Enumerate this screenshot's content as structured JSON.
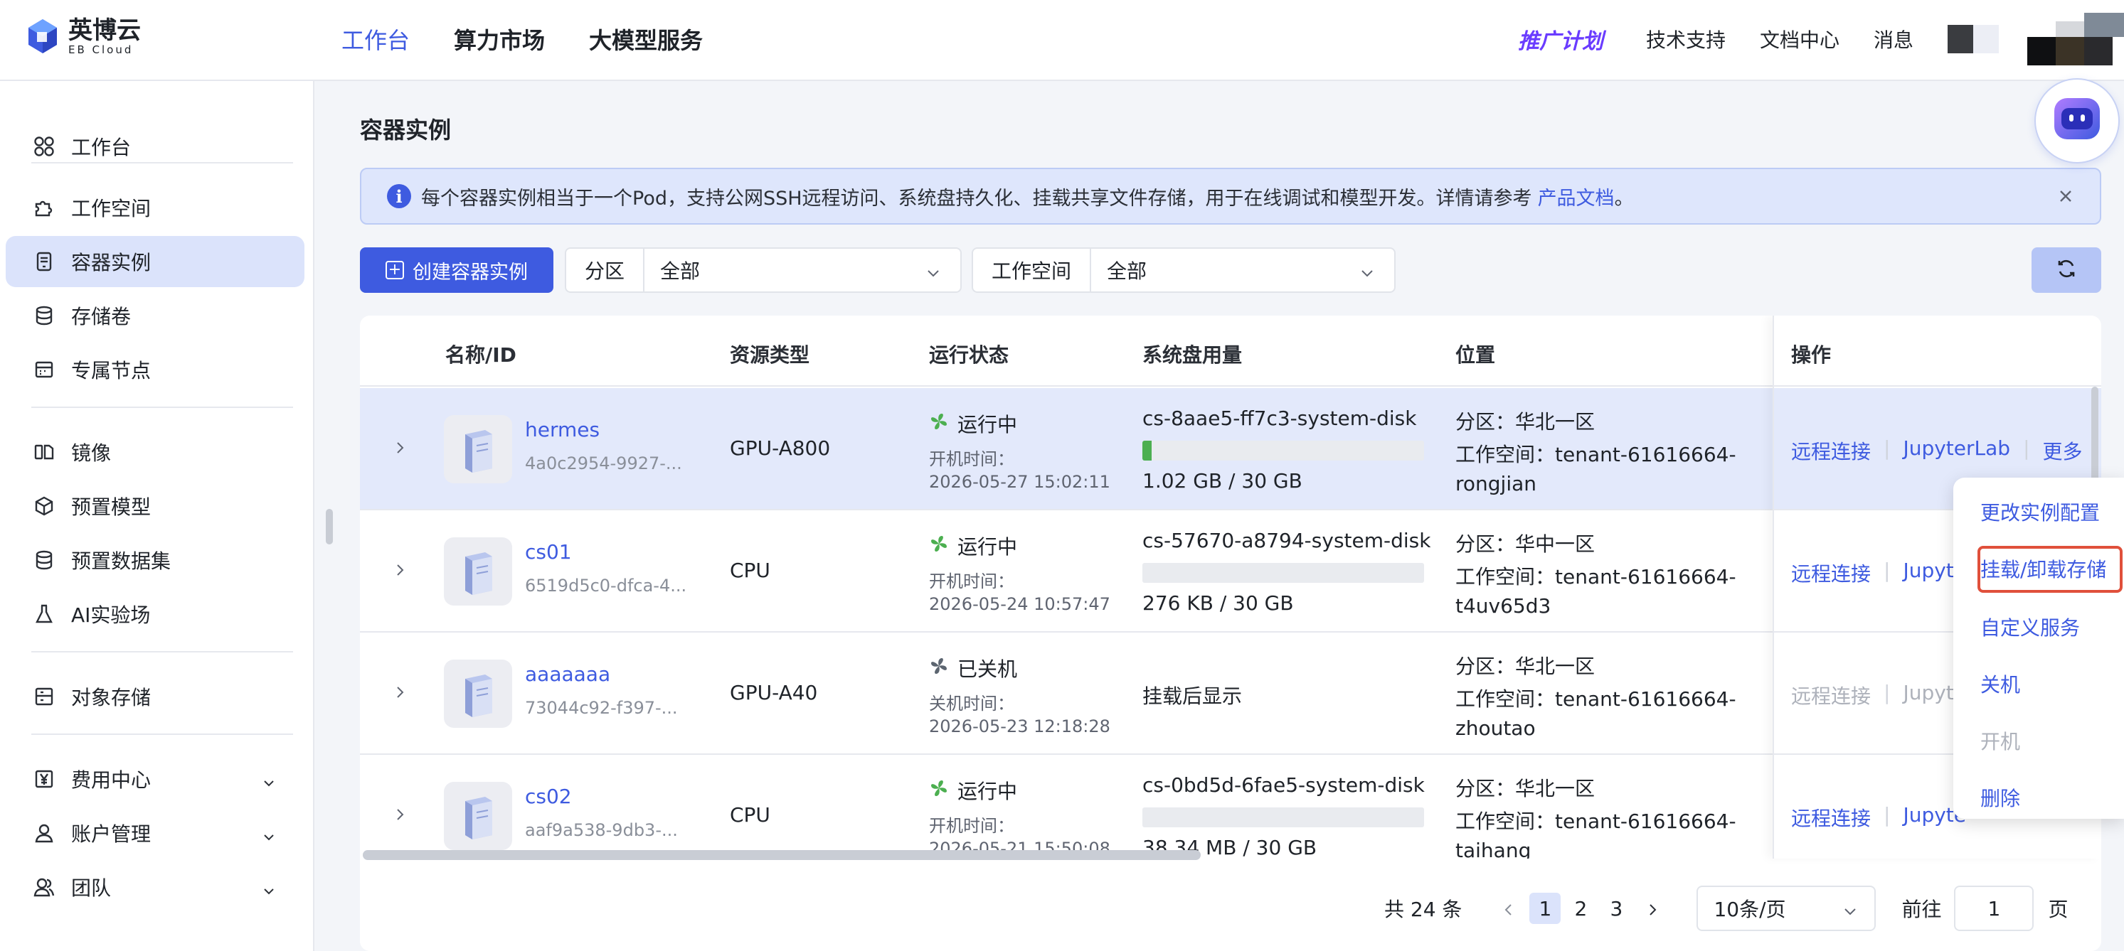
{
  "app": {
    "logo_cn": "英博云",
    "logo_en": "EB Cloud"
  },
  "topnav": {
    "items": [
      "工作台",
      "算力市场",
      "大模型服务"
    ],
    "promo": "推广计划",
    "links": [
      "技术支持",
      "文档中心",
      "消息"
    ]
  },
  "sidebar": {
    "items": [
      {
        "label": "工作台",
        "icon": "grid-icon"
      },
      {
        "label": "工作空间",
        "icon": "puzzle-icon"
      },
      {
        "label": "容器实例",
        "icon": "container-icon"
      },
      {
        "label": "存储卷",
        "icon": "database-icon"
      },
      {
        "label": "专属节点",
        "icon": "server-node-icon"
      },
      {
        "label": "镜像",
        "icon": "image-icon"
      },
      {
        "label": "预置模型",
        "icon": "cube-icon"
      },
      {
        "label": "预置数据集",
        "icon": "dataset-icon"
      },
      {
        "label": "AI实验场",
        "icon": "flask-icon"
      },
      {
        "label": "对象存储",
        "icon": "object-storage-icon"
      },
      {
        "label": "费用中心",
        "icon": "yen-icon"
      },
      {
        "label": "账户管理",
        "icon": "user-icon"
      },
      {
        "label": "团队",
        "icon": "team-icon"
      }
    ]
  },
  "page": {
    "title": "容器实例",
    "notice_text": "每个容器实例相当于一个Pod，支持公网SSH远程访问、系统盘持久化、挂载共享文件存储，用于在线调试和模型开发。详情请参考",
    "notice_link": "产品文档",
    "notice_end": "。",
    "create_button": "创建容器实例",
    "filter_zone_label": "分区",
    "filter_zone_value": "全部",
    "filter_ws_label": "工作空间",
    "filter_ws_value": "全部"
  },
  "table": {
    "headers": [
      "名称/ID",
      "资源类型",
      "运行状态",
      "系统盘用量",
      "位置",
      "操作"
    ],
    "rows": [
      {
        "name": "hermes",
        "id": "4a0c2954-9927-...",
        "resource": "GPU-A800",
        "status": "运行中",
        "time_label": "开机时间：",
        "time": "2026-05-27 15:02:11",
        "disk": "cs-8aae5-ff7c3-system-disk",
        "disk_fill": 0.034,
        "usage": "1.02 GB / 30 GB",
        "zone": "分区：华北一区",
        "ws1": "工作空间：tenant-61616664-",
        "ws2": "rongjian",
        "ops": [
          "远程连接",
          "JupyterLab",
          "更多"
        ]
      },
      {
        "name": "cs01",
        "id": "6519d5c0-dfca-4...",
        "resource": "CPU",
        "status": "运行中",
        "time_label": "开机时间：",
        "time": "2026-05-24 10:57:47",
        "disk": "cs-57670-a8794-system-disk",
        "disk_fill": 0.0,
        "usage": "276 KB / 30 GB",
        "zone": "分区：华中一区",
        "ws1": "工作空间：tenant-61616664-",
        "ws2": "t4uv65d3",
        "ops": [
          "远程连接",
          "Jupyte"
        ]
      },
      {
        "name": "aaaaaaa",
        "id": "73044c92-f397-...",
        "resource": "GPU-A40",
        "status": "已关机",
        "time_label": "关机时间：",
        "time": "2026-05-23 12:18:28",
        "disk_text": "挂载后显示",
        "zone": "分区：华北一区",
        "ws1": "工作空间：tenant-61616664-",
        "ws2": "zhoutao",
        "ops": [
          "远程连接",
          "Jupyte"
        ]
      },
      {
        "name": "cs02",
        "id": "aaf9a538-9db3-...",
        "resource": "CPU",
        "status": "运行中",
        "time_label": "开机时间：",
        "time": "2026-05-21 15:50:08",
        "disk": "cs-0bd5d-6fae5-system-disk",
        "disk_fill": 0.0,
        "usage": "38.34 MB / 30 GB",
        "zone": "分区：华北一区",
        "ws1": "工作空间：tenant-61616664-",
        "ws2": "taihang",
        "ops": [
          "远程连接",
          "Jupyte"
        ]
      }
    ]
  },
  "pagination": {
    "total": "共 24 条",
    "pages": [
      "1",
      "2",
      "3"
    ],
    "current": "1",
    "page_size": "10条/页",
    "goto_label": "前往",
    "goto_value": "1",
    "page_suffix": "页"
  },
  "dropdown": {
    "items": [
      "更改实例配置",
      "挂载/卸载存储",
      "自定义服务",
      "关机",
      "开机",
      "删除"
    ]
  },
  "colors": {
    "accent": "#3e5be0",
    "running": "#4caf50",
    "stopped": "#5c6570",
    "focus_outline": "#e0503b"
  }
}
